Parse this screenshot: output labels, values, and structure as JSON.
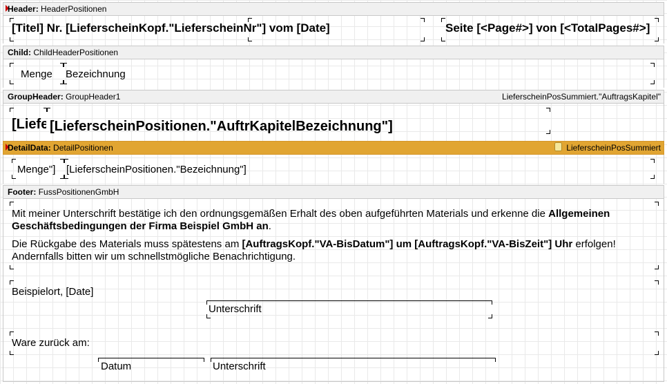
{
  "bands": {
    "header": {
      "type": "Header",
      "name": "HeaderPositionen"
    },
    "child": {
      "type": "Child",
      "name": "ChildHeaderPositionen"
    },
    "group": {
      "type": "GroupHeader",
      "name": "GroupHeader1",
      "condition": "LieferscheinPosSummiert.\"AuftragsKapitel\""
    },
    "detail": {
      "type": "DetailData",
      "name": "DetailPositionen",
      "datasource": "LieferscheinPosSummiert"
    },
    "footer": {
      "type": "Footer",
      "name": "FussPositionenGmbH"
    }
  },
  "colon": ":",
  "header_fields": {
    "title": "[Titel] Nr. [LieferscheinKopf.\"LieferscheinNr\"] vom [Date]",
    "page": "Seite [<Page#>] von [<TotalPages#>]"
  },
  "child_fields": {
    "qty": "Menge",
    "desc": "Bezeichnung"
  },
  "group_fields": {
    "short": "[Liefe",
    "chapter": "[LieferscheinPositionen.\"AuftrKapitelBezeichnung\"]"
  },
  "detail_fields": {
    "qty": "Menge\"]",
    "desc": "[LieferscheinPositionen.\"Bezeichnung\"]"
  },
  "footer_texts": {
    "p1_a": "Mit meiner Unterschrift bestätige ich den ordnungsgemäßen Erhalt des oben aufgeführten Materials und erkenne die ",
    "p1_b": "Allgemeinen Geschäftsbedingungen der Firma Beispiel GmbH an",
    "p1_c": ".",
    "p2_a": "Die Rückgabe des Materials muss spätestens am ",
    "p2_b": "[AuftragsKopf.\"VA-BisDatum\"] um [AuftragsKopf.\"VA-BisZeit\"] Uhr",
    "p2_c": " erfolgen! Andernfalls bitten wir um schnellstmögliche Benachrichtigung.",
    "place": "Beispielort, [Date]",
    "signature1": "Unterschrift",
    "return_label": "Ware zurück am:",
    "date": "Datum",
    "signature2": "Unterschrift"
  }
}
